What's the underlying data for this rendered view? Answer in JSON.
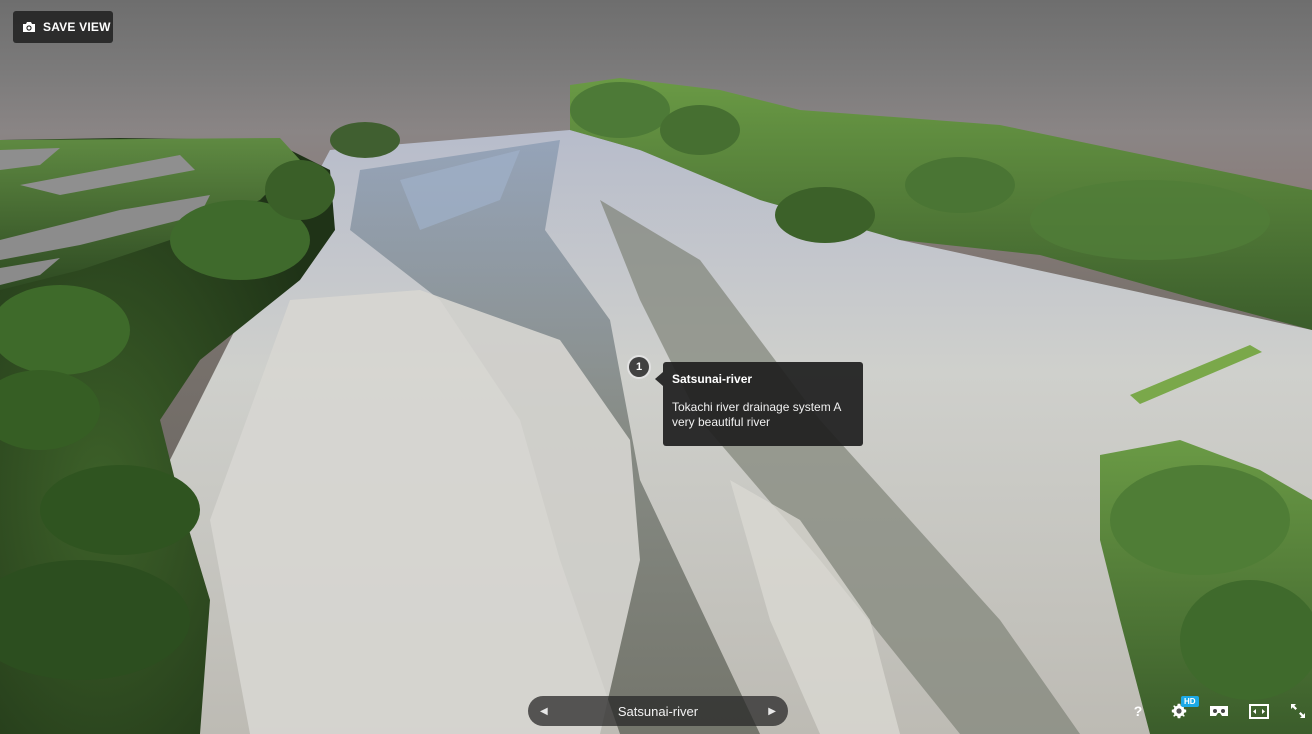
{
  "toolbar": {
    "save_view_label": "SAVE VIEW",
    "save_view_icon": "camera-icon"
  },
  "annotation": {
    "number": "1",
    "title": "Satsunai-river",
    "description": "Tokachi river drainage system A very beautiful river"
  },
  "navigator": {
    "current_label": "Satsunai-river",
    "prev_icon": "chevron-left-icon",
    "next_icon": "chevron-right-icon"
  },
  "controls": {
    "help_label": "?",
    "hd_badge": "HD",
    "settings_icon": "gear-icon",
    "vr_icon": "vr-headset-icon",
    "theatre_icon": "theatre-mode-icon",
    "fullscreen_icon": "fullscreen-icon"
  },
  "colors": {
    "hd_badge": "#1ca9e6",
    "panel_bg": "#1e1e1e",
    "moss_green": "#4f7a33",
    "gravel": "#c9c9c4",
    "water": "#6f7a78"
  }
}
